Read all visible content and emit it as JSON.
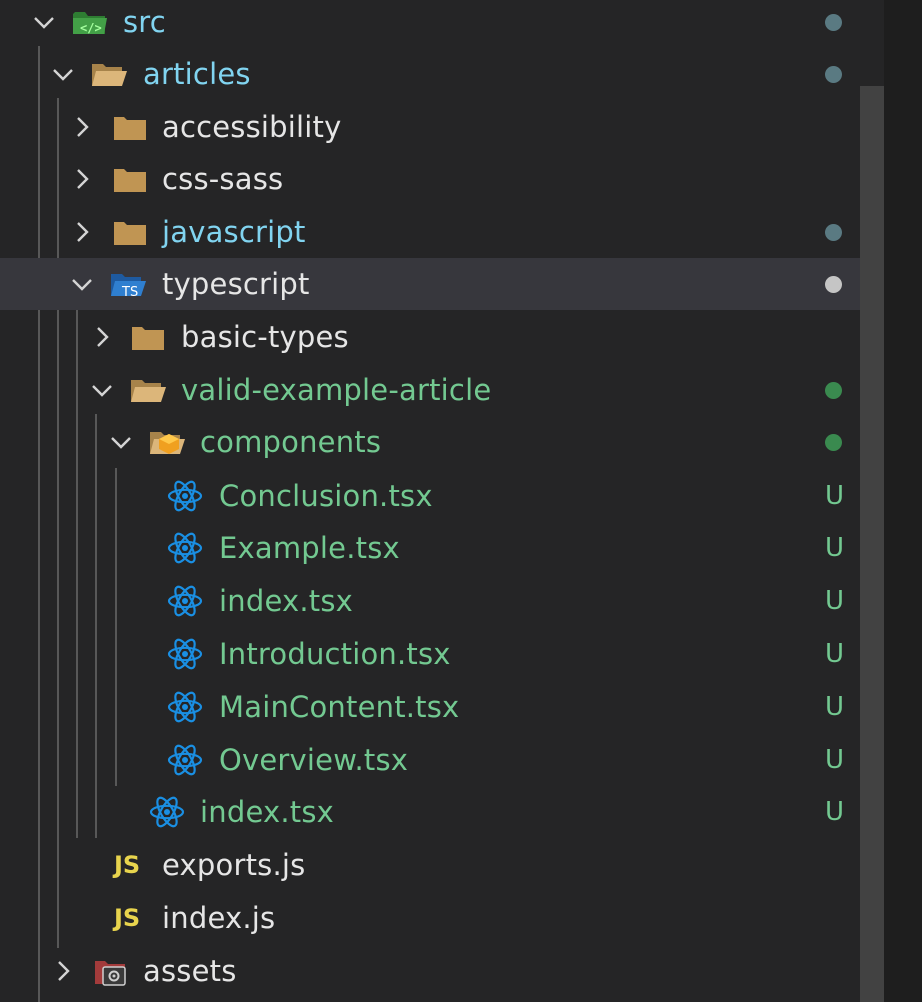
{
  "colors": {
    "folder": "#c09553",
    "react": "#1a8fe3",
    "untracked": "#73c991",
    "modified": "#81b4d9",
    "dot_default": "#5a7a82",
    "js": "#e8d44d",
    "text": "#e6e6e6"
  },
  "tree": [
    {
      "label": "src",
      "icon": "src-folder-icon",
      "expanded": true,
      "label_color": "#81d4f0",
      "badge": "dot"
    },
    {
      "label": "articles",
      "icon": "folder-open-icon",
      "expanded": true,
      "label_color": "#81d4f0",
      "badge": "dot"
    },
    {
      "label": "accessibility",
      "icon": "folder-icon",
      "expanded": false,
      "label_color": "#e6e6e6",
      "badge": ""
    },
    {
      "label": "css-sass",
      "icon": "folder-icon",
      "expanded": false,
      "label_color": "#e6e6e6",
      "badge": ""
    },
    {
      "label": "javascript",
      "icon": "folder-icon",
      "expanded": false,
      "label_color": "#81d4f0",
      "badge": "dot"
    },
    {
      "label": "typescript",
      "icon": "typescript-folder-icon",
      "expanded": true,
      "label_color": "#e6e6e6",
      "badge": "dot",
      "selected": true
    },
    {
      "label": "basic-types",
      "icon": "folder-icon",
      "expanded": false,
      "label_color": "#e6e6e6",
      "badge": ""
    },
    {
      "label": "valid-example-article",
      "icon": "folder-open-icon",
      "expanded": true,
      "label_color": "#73c991",
      "badge": "dot"
    },
    {
      "label": "components",
      "icon": "components-folder-icon",
      "expanded": true,
      "label_color": "#73c991",
      "badge": "dot"
    },
    {
      "label": "Conclusion.tsx",
      "icon": "react-icon",
      "label_color": "#73c991",
      "badge": "U"
    },
    {
      "label": "Example.tsx",
      "icon": "react-icon",
      "label_color": "#73c991",
      "badge": "U"
    },
    {
      "label": "index.tsx",
      "icon": "react-icon",
      "label_color": "#73c991",
      "badge": "U"
    },
    {
      "label": "Introduction.tsx",
      "icon": "react-icon",
      "label_color": "#73c991",
      "badge": "U"
    },
    {
      "label": "MainContent.tsx",
      "icon": "react-icon",
      "label_color": "#73c991",
      "badge": "U"
    },
    {
      "label": "Overview.tsx",
      "icon": "react-icon",
      "label_color": "#73c991",
      "badge": "U"
    },
    {
      "label": "index.tsx",
      "icon": "react-icon",
      "label_color": "#73c991",
      "badge": "U"
    },
    {
      "label": "exports.js",
      "icon": "js-icon",
      "label_color": "#e6e6e6",
      "badge": ""
    },
    {
      "label": "index.js",
      "icon": "js-icon",
      "label_color": "#e6e6e6",
      "badge": ""
    },
    {
      "label": "assets",
      "icon": "assets-folder-icon",
      "expanded": false,
      "label_color": "#e6e6e6",
      "badge": ""
    }
  ],
  "js_icon_text": "JS",
  "ts_icon_text": "TS",
  "untracked_badge": "U"
}
